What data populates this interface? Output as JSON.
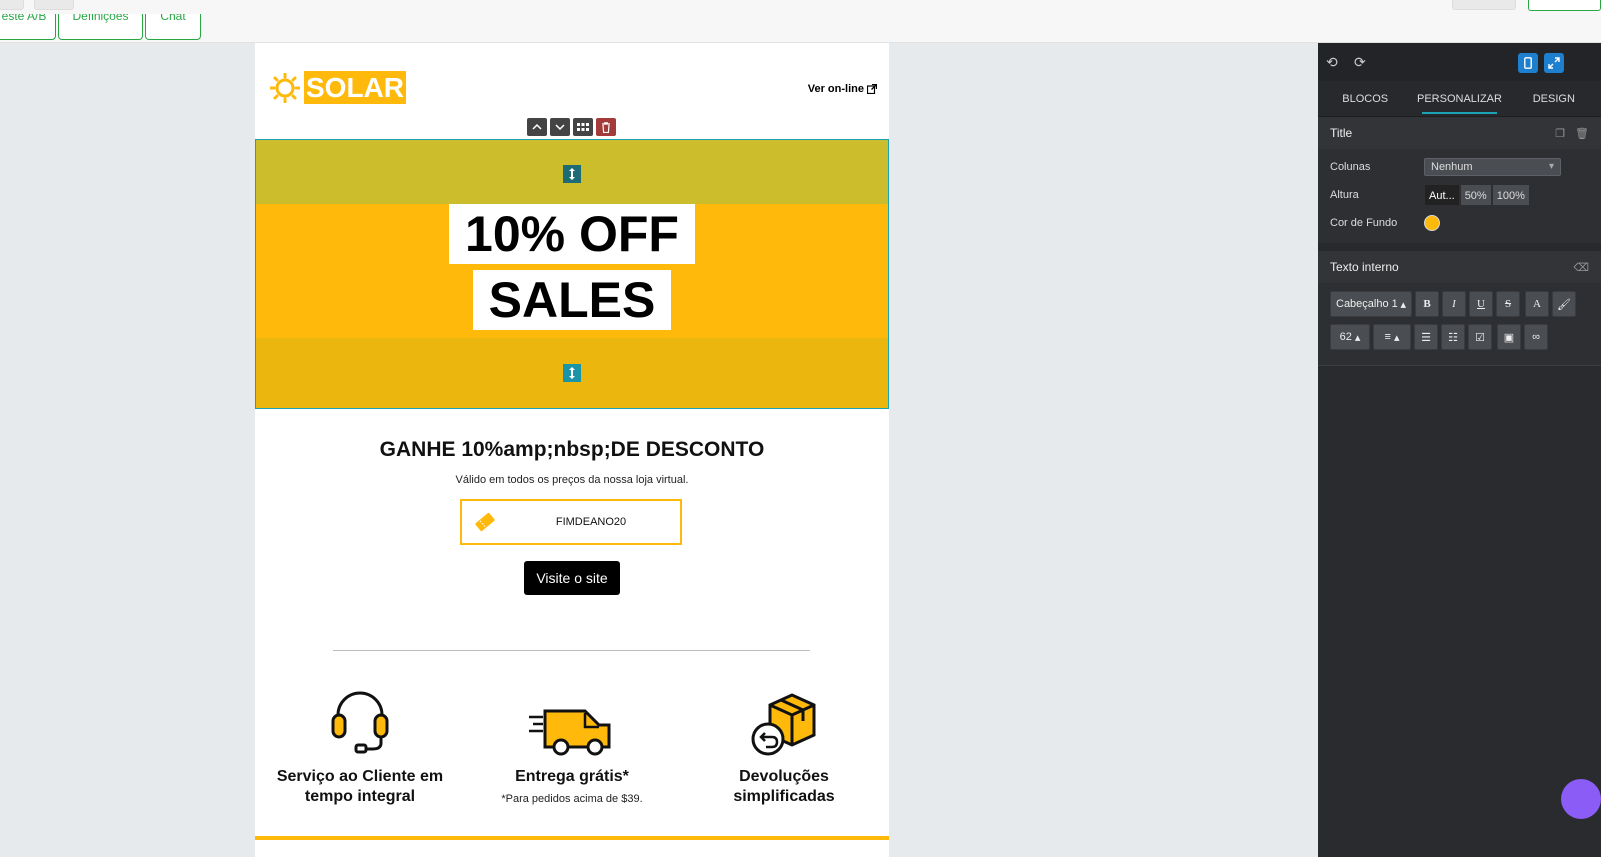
{
  "topbar": {
    "tab1": "Teste A/B",
    "tab2": "Definições",
    "tab3": "Chat"
  },
  "email": {
    "logo_text": "SOLAR",
    "view_online": "Ver on-line",
    "hero_line1": "10% OFF",
    "hero_line2": "SALES",
    "discount_title": "GANHE 10%amp;nbsp;DE DESCONTO",
    "discount_sub": "Válido em todos os preços da nossa loja virtual.",
    "coupon_code": "FIMDEANO20",
    "visit_button": "Visite o site",
    "features": [
      {
        "title": "Serviço ao Cliente em tempo integral",
        "note": ""
      },
      {
        "title": "Entrega grátis*",
        "note": "*Para pedidos acima de $39."
      },
      {
        "title": "Devoluções simplificadas",
        "note": ""
      }
    ],
    "accent_color": "#ffb90b"
  },
  "panel": {
    "tabs": [
      "BLOCOS",
      "PERSONALIZAR",
      "DESIGN"
    ],
    "active_tab": "PERSONALIZAR",
    "section_title": "Title",
    "columns_label": "Colunas",
    "columns_value": "Nenhum",
    "height_label": "Altura",
    "height_options": [
      "Aut...",
      "50%",
      "100%"
    ],
    "bg_label": "Cor de Fundo",
    "bg_color": "#ffb90b",
    "inner_text_title": "Texto interno",
    "heading_select": "Cabeçalho 1",
    "font_size": "62"
  }
}
